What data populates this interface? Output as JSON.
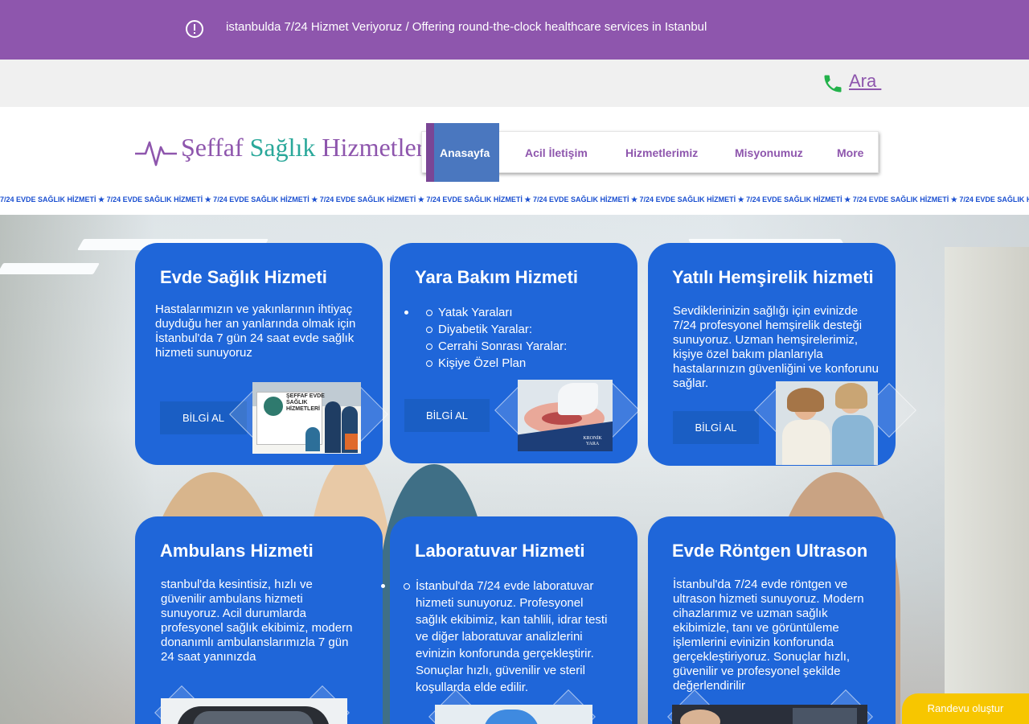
{
  "topbar": {
    "message": "istanbulda 7/24 Hizmet Veriyoruz / Offering round-the-clock healthcare services in Istanbul",
    "icon": "alert-circle-icon"
  },
  "callbar": {
    "call_label": "Ara ",
    "icon": "phone-icon",
    "icon_color": "#23b24b"
  },
  "logo": {
    "word1": "Şeffaf",
    "word2": "Sağlık",
    "word3": "Hizmetleri"
  },
  "nav": {
    "items": [
      "Anasayfa",
      "Acil İletişim",
      "Hizmetlerimiz",
      "Misyonumuz",
      "More"
    ],
    "active": "Anasayfa"
  },
  "marquee": {
    "text": "7/24 EVDE SAĞLIK HİZMETİ ★ 7/24 EVDE SAĞLIK HİZMETİ ★ 7/24 EVDE SAĞLIK HİZMETİ ★ 7/24 EVDE SAĞLIK HİZMETİ ★ 7/24 EVDE SAĞLIK HİZMETİ ★ 7/24 EVDE SAĞLIK HİZMETİ ★ 7/24 EVDE SAĞLIK HİZMETİ ★ 7/24 EVDE SAĞLIK HİZMETİ ★ 7/24 EVDE SAĞLIK HİZMETİ ★ 7/24 EVDE SAĞLIK HİZMETİ ★ 7/24 EVDE SAĞLIK"
  },
  "cards": [
    {
      "title": "Evde Sağlık Hizmeti",
      "text": "Hastalarımızın ve yakınlarının ihtiyaç duyduğu her an yanlarında olmak için İstanbul'da 7 gün 24 saat evde sağlık hizmeti sunuyoruz",
      "button": "BİLGİ AL",
      "image_text": "ŞEFFAF EVDE SAĞLIK HİZMETLERİ"
    },
    {
      "title": "Yara Bakım Hizmeti",
      "list": [
        "Yatak Yaraları",
        "Diyabetik Yaralar:",
        "Cerrahi Sonrası Yaralar:",
        "Kişiye Özel Plan"
      ],
      "button": "BİLGİ AL",
      "image_text": "KRONİK YARA"
    },
    {
      "title": "Yatılı Hemşirelik hizmeti",
      "text": "Sevdiklerinizin sağlığı için evinizde 7/24 profesyonel hemşirelik desteği sunuyoruz. Uzman hemşirelerimiz, kişiye özel bakım planlarıyla hastalarınızın güvenliğini ve konforunu sağlar.",
      "button": "BİLGİ AL"
    },
    {
      "title": "Ambulans Hizmeti",
      "text": "stanbul'da kesintisiz, hızlı ve güvenilir ambulans hizmeti sunuyoruz. Acil durumlarda profesyonel sağlık ekibimiz, modern donanımlı ambulanslarımızla 7 gün 24 saat yanınızda"
    },
    {
      "title": "Laboratuvar Hizmeti",
      "list": [
        "İstanbul'da 7/24 evde laboratuvar hizmeti sunuyoruz. Profesyonel sağlık ekibimiz, kan tahlili, idrar testi ve diğer laboratuvar analizlerini evinizin konforunda gerçekleştirir. Sonuçlar hızlı, güvenilir ve steril koşullarda elde edilir."
      ]
    },
    {
      "title": "Evde Röntgen Ultrason",
      "text": "İstanbul'da 7/24 evde röntgen ve ultrason hizmeti sunuyoruz. Modern cihazlarımız ve uzman sağlık ekibimizle, tanı ve görüntüleme işlemlerini evinizin konforunda gerçekleştiriyoruz. Sonuçlar hızlı, güvenilir ve profesyonel şekilde değerlendirilir"
    }
  ],
  "randevu": {
    "label": "Randevu oluştur"
  },
  "colors": {
    "brand_purple": "#8e56ad",
    "brand_teal": "#2aa89a",
    "card_blue": "#1f66d9",
    "nav_active": "#4a77bf",
    "marquee_blue": "#1a4fd0",
    "cta_yellow": "#f7c600"
  }
}
